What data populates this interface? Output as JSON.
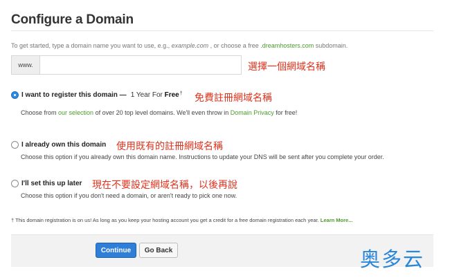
{
  "page": {
    "title": "Configure a Domain",
    "intro": {
      "part1": "To get started, type a domain name you want to use, e.g., ",
      "example": "example.com",
      "part2": " , or choose a free ",
      "free_domain": ".dreamhosters.com",
      "part3": " subdomain."
    }
  },
  "domain_input": {
    "prefix": "www.",
    "value": "",
    "annotation": "選擇一個網域名稱"
  },
  "options": {
    "register": {
      "selected": true,
      "label": "I want to register this domain —",
      "extra": "1 Year For",
      "extra_bold": "Free",
      "dagger": "†",
      "annotation": "免費註冊網域名稱",
      "desc_part1": "Choose from ",
      "desc_link1": "our selection",
      "desc_part2": " of over 20 top level domains. We'll even throw in ",
      "desc_link2": "Domain Privacy",
      "desc_part3": " for free!"
    },
    "own": {
      "selected": false,
      "label": "I already own this domain",
      "annotation": "使用既有的註冊網域名稱",
      "desc": "Choose this option if you already own this domain name. Instructions to update your DNS will be sent after you complete your order."
    },
    "later": {
      "selected": false,
      "label": "I'll set this up later",
      "annotation": "現在不要設定網域名稱，以後再說",
      "desc": "Choose this option if you don't need a domain, or aren't ready to pick one now."
    }
  },
  "footnote": {
    "text": "† This domain registration is on us! As long as you keep your hosting account you get a credit for a free domain registration each year. ",
    "link": "Learn More..."
  },
  "buttons": {
    "continue": "Continue",
    "back": "Go Back"
  },
  "watermark": "奥多云",
  "colors": {
    "accent_green": "#4c9a2a",
    "primary_blue": "#2f7fd8",
    "annotation_red": "#e0321d",
    "watermark_blue": "#2a86d8"
  }
}
